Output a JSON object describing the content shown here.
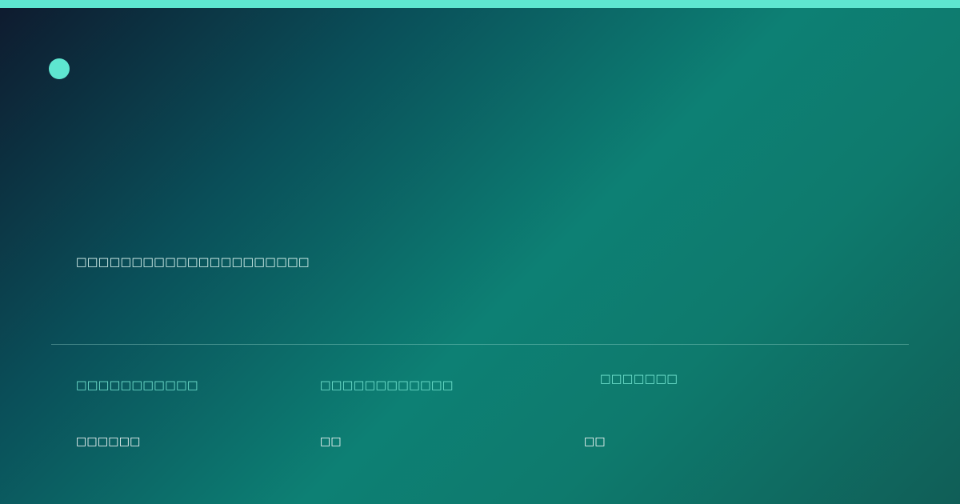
{
  "card": {
    "headline": "□□□□□□□□□□□□□□□□□□□□□",
    "stats": [
      {
        "label": "□□□□□□□□□□□",
        "value": "□□□□□□"
      },
      {
        "label": "□□□□□□□□□□□□",
        "value": "□□"
      },
      {
        "label": "□□□□□□□",
        "value": "□□"
      }
    ]
  },
  "colors": {
    "accent": "#5ee6d0",
    "label_text": "#74e6d2",
    "value_text": "#ffffff",
    "background_start": "#0e1a2e",
    "background_mid": "#0d8074",
    "background_end": "#105e57"
  },
  "icons": {
    "brand_mark": "brand-dot-icon"
  }
}
